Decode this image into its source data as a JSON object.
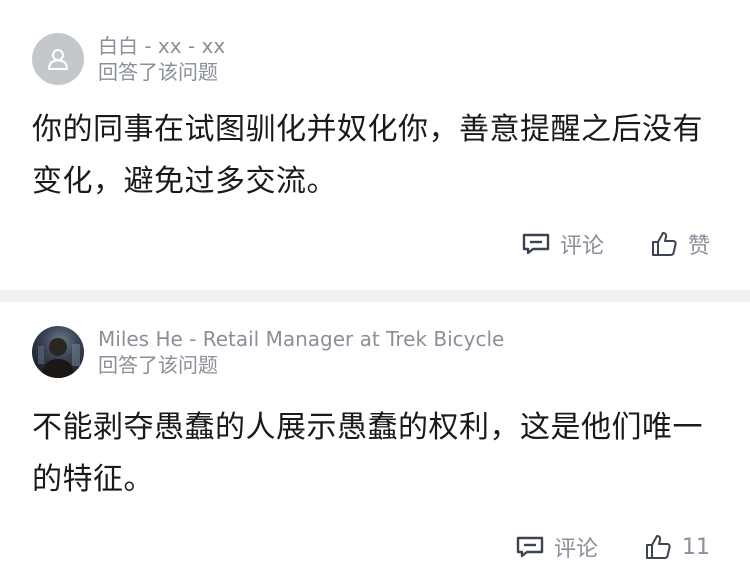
{
  "answers": [
    {
      "author_line": "白白 - xx - xx",
      "action_text": "回答了该问题",
      "content": "你的同事在试图驯化并奴化你，善意提醒之后没有变化，避免过多交流。",
      "comment_label": "评论",
      "like_label": "赞",
      "avatar_icon": "person-icon"
    },
    {
      "author_line": "Miles He - Retail Manager at Trek Bicycle",
      "action_text": "回答了该问题",
      "content": "不能剥夺愚蠢的人展示愚蠢的权利，这是他们唯一的特征。",
      "comment_label": "评论",
      "like_label": "11",
      "avatar_icon": "user-photo"
    }
  ],
  "icons": {
    "comment": "comment-icon",
    "like": "thumbs-up-icon"
  },
  "colors": {
    "text_primary": "#1a1a1a",
    "text_secondary": "#8a8f99",
    "divider": "#f0f1f3",
    "default_avatar": "#c4c7cc"
  }
}
